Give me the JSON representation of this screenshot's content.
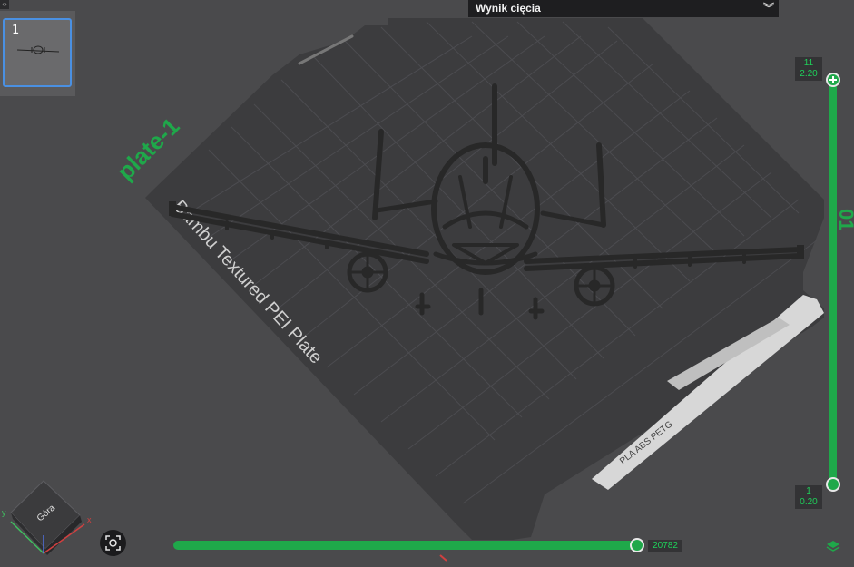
{
  "thumbnail": {
    "number": "1"
  },
  "header": {
    "title": "Wynik cięcia"
  },
  "plate": {
    "name": "plate-1",
    "type": "Bambu Textured PEI Plate",
    "filaments": "PLA ABS PETG",
    "side_text": "01"
  },
  "layer_slider": {
    "top_layer": "11",
    "top_height": "2.20",
    "bottom_layer": "1",
    "bottom_height": "0.20"
  },
  "progress": {
    "value": "20782",
    "fraction": 1.0
  },
  "view_cube": {
    "face": "Góra",
    "axis_x": "x",
    "axis_y": "y"
  },
  "colors": {
    "accent": "#1fa84a",
    "plate": "#3b3b3d",
    "model": "#2a2a2a"
  }
}
